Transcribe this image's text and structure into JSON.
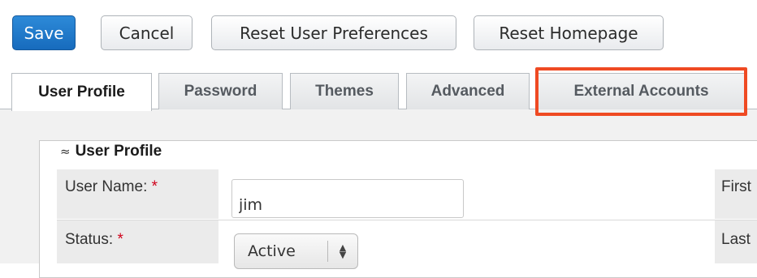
{
  "toolbar": {
    "save_label": "Save",
    "cancel_label": "Cancel",
    "reset_prefs_label": "Reset User Preferences",
    "reset_home_label": "Reset Homepage"
  },
  "tabs": [
    {
      "label": "User Profile",
      "active": true
    },
    {
      "label": "Password",
      "active": false
    },
    {
      "label": "Themes",
      "active": false
    },
    {
      "label": "Advanced",
      "active": false
    },
    {
      "label": "External Accounts",
      "active": false,
      "highlighted": true
    }
  ],
  "section": {
    "toggle_icon": "double-chevron-up-icon",
    "title": "User Profile"
  },
  "form": {
    "username_label": "User Name:",
    "username_value": "jim",
    "status_label": "Status:",
    "status_value": "Active",
    "first_label_partial": "First",
    "last_label_partial": "Last",
    "required_mark": "*"
  },
  "colors": {
    "primary": "#1f78c9",
    "highlight": "#ef4a23",
    "required": "#d0021b"
  }
}
